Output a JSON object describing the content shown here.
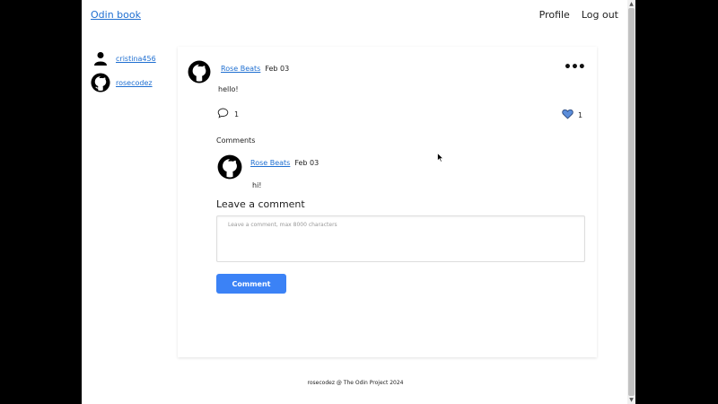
{
  "header": {
    "brand": "Odin book",
    "nav": {
      "profile": "Profile",
      "logout": "Log out"
    }
  },
  "sidebar": {
    "users": [
      {
        "name": "cristina456",
        "avatar_icon": "user-silhouette-icon"
      },
      {
        "name": "rosecodez",
        "avatar_icon": "github-icon"
      }
    ]
  },
  "post": {
    "author": "Rose Beats",
    "date": "Feb 03",
    "text": "hello!",
    "comment_count": "1",
    "like_count": "1",
    "more_label": "•••"
  },
  "comments": {
    "heading": "Comments",
    "items": [
      {
        "author": "Rose Beats",
        "date": "Feb 03",
        "text": "hi!"
      }
    ]
  },
  "comment_form": {
    "heading": "Leave a comment",
    "placeholder": "Leave a comment, max 8000 characters",
    "submit_label": "Comment"
  },
  "footer": {
    "text": "rosecodez @ The Odin Project 2024"
  },
  "colors": {
    "link": "#1f6fd1",
    "button": "#3b82f6",
    "heart": "#5b8dd9"
  }
}
